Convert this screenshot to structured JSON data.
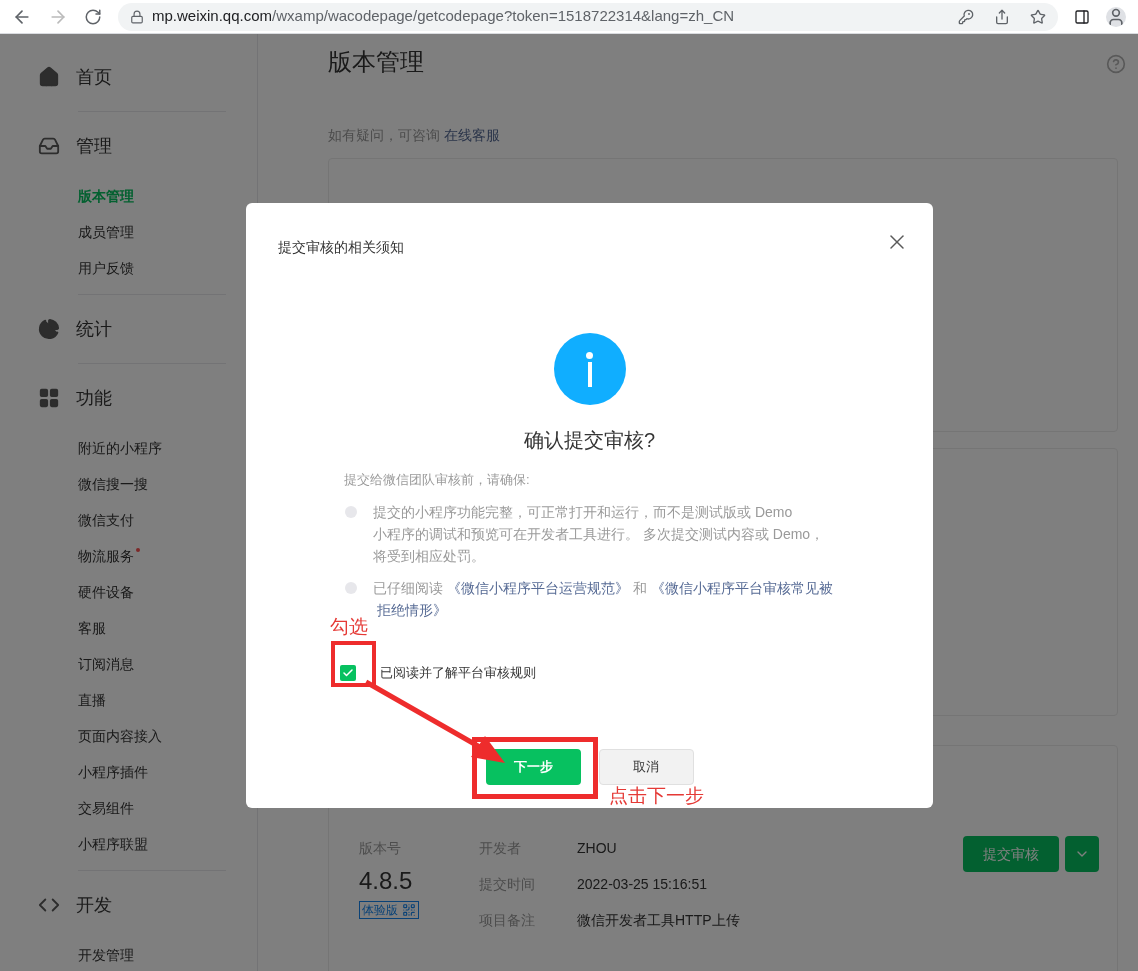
{
  "browser": {
    "url_host": "mp.weixin.qq.com",
    "url_path": "/wxamp/wacodepage/getcodepage?token=1518722314&lang=zh_CN"
  },
  "sidebar": {
    "sections": [
      {
        "kind": "home",
        "label": "首页"
      },
      {
        "kind": "manage",
        "label": "管理",
        "items": [
          {
            "label": "版本管理",
            "selected": true,
            "notice": false
          },
          {
            "label": "成员管理",
            "selected": false,
            "notice": false
          },
          {
            "label": "用户反馈",
            "selected": false,
            "notice": false
          }
        ]
      },
      {
        "kind": "stats",
        "label": "统计"
      },
      {
        "kind": "features",
        "label": "功能",
        "items": [
          {
            "label": "附近的小程序",
            "selected": false,
            "notice": false
          },
          {
            "label": "微信搜一搜",
            "selected": false,
            "notice": false
          },
          {
            "label": "微信支付",
            "selected": false,
            "notice": false
          },
          {
            "label": "物流服务",
            "selected": false,
            "notice": true
          },
          {
            "label": "硬件设备",
            "selected": false,
            "notice": false
          },
          {
            "label": "客服",
            "selected": false,
            "notice": false
          },
          {
            "label": "订阅消息",
            "selected": false,
            "notice": false
          },
          {
            "label": "直播",
            "selected": false,
            "notice": false
          },
          {
            "label": "页面内容接入",
            "selected": false,
            "notice": false
          },
          {
            "label": "小程序插件",
            "selected": false,
            "notice": false
          },
          {
            "label": "交易组件",
            "selected": false,
            "notice": false
          },
          {
            "label": "小程序联盟",
            "selected": false,
            "notice": false
          }
        ]
      },
      {
        "kind": "dev",
        "label": "开发",
        "items": [
          {
            "label": "开发管理",
            "selected": false,
            "notice": false
          }
        ]
      }
    ]
  },
  "main": {
    "title": "版本管理",
    "help_text": "如有疑问，可咨询",
    "help_link": "在线客服",
    "online_card": {
      "kind": "card"
    },
    "version_card": {
      "version_label": "版本号",
      "version": "4.8.5",
      "badge": "体验版",
      "fields": [
        {
          "label": "开发者",
          "value": "ZHOU"
        },
        {
          "label": "提交时间",
          "value": "2022-03-25 15:16:51"
        },
        {
          "label": "项目备注",
          "value": "微信开发者工具HTTP上传"
        }
      ],
      "submit": "提交审核"
    }
  },
  "modal": {
    "title": "提交审核的相关须知",
    "heading": "确认提交审核?",
    "intro": "提交给微信团队审核前，请确保:",
    "bullets": [
      {
        "lines": [
          [
            {
              "kind": "text",
              "text": "提交的小程序功能完整，可正常打开和运行，而不是测试版或 Demo"
            }
          ],
          [
            {
              "kind": "text",
              "text": "小程序的调试和预览可在开发者工具进行。 多次提交测试内容或 Demo，"
            }
          ],
          [
            {
              "kind": "text",
              "text": "将受到相应处罚。"
            }
          ]
        ]
      },
      {
        "lines": [
          [
            {
              "kind": "text",
              "text": "已仔细阅读"
            },
            {
              "kind": "link",
              "text": "《微信小程序平台运营规范》"
            },
            {
              "kind": "text",
              "text": "和"
            },
            {
              "kind": "link",
              "text": "《微信小程序平台审核常见被"
            }
          ],
          [
            {
              "kind": "link",
              "text": "拒绝情形》"
            }
          ]
        ]
      }
    ],
    "checkbox": {
      "label": "已阅读并了解平台审核规则",
      "checked": true
    },
    "buttons": [
      {
        "label": "下一步",
        "kind": "primary"
      },
      {
        "label": "取消",
        "kind": "default"
      }
    ]
  },
  "annotations": {
    "check_note": "勾选",
    "next_note": "点击下一步"
  }
}
